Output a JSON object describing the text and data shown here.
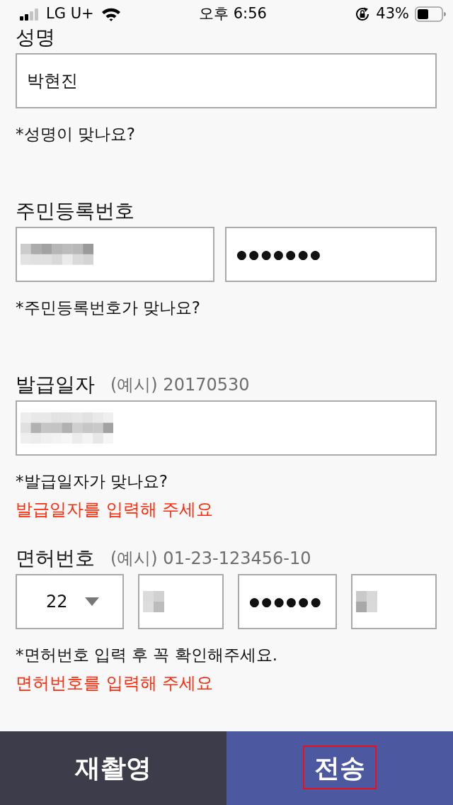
{
  "status_bar": {
    "carrier": "LG U+",
    "time": "오후 6:56",
    "battery": "43%"
  },
  "sections": [
    {
      "label": "성명",
      "fields": [
        {
          "kind": "text",
          "value": "박현진"
        }
      ],
      "notes": [
        {
          "kind": "hint",
          "text": "*성명이 맞나요?"
        }
      ]
    },
    {
      "label": "주민등록번호",
      "fields": [
        {
          "kind": "masked"
        },
        {
          "kind": "text",
          "value": "●●●●●●●"
        }
      ],
      "notes": [
        {
          "kind": "hint",
          "text": "*주민등록번호가 맞나요?"
        }
      ]
    },
    {
      "label": "발급일자",
      "example": "(예시) 20170530",
      "fields": [
        {
          "kind": "masked"
        }
      ],
      "notes": [
        {
          "kind": "hint",
          "text": "*발급일자가 맞나요?"
        },
        {
          "kind": "error",
          "text": "발급일자를 입력해 주세요"
        }
      ]
    },
    {
      "label": "면허번호",
      "example": "(예시) 01-23-123456-10",
      "fields": [
        {
          "kind": "select",
          "value": "22"
        },
        {
          "kind": "masked"
        },
        {
          "kind": "text",
          "value": "●●●●●●"
        },
        {
          "kind": "masked"
        }
      ],
      "notes": [
        {
          "kind": "hint",
          "text": "*면허번호 입력 후 꼭 확인해주세요."
        },
        {
          "kind": "error",
          "text": "면허번호를 입력해 주세요"
        }
      ]
    }
  ],
  "bottom_bar": {
    "buttons": [
      {
        "kind": "secondary",
        "label": "재촬영",
        "highlighted": false
      },
      {
        "kind": "primary",
        "label": "전송",
        "highlighted": true
      }
    ]
  }
}
